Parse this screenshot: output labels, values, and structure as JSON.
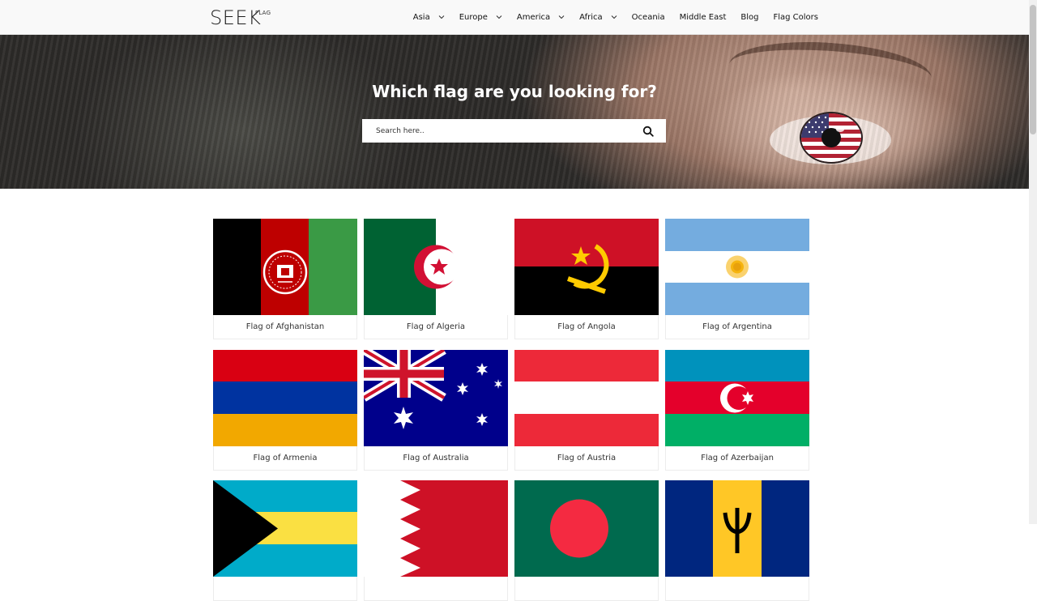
{
  "header": {
    "logo_main": "SEEK",
    "logo_sup": "FLAG",
    "nav": [
      {
        "label": "Asia",
        "dropdown": true
      },
      {
        "label": "Europe",
        "dropdown": true
      },
      {
        "label": "America",
        "dropdown": true
      },
      {
        "label": "Africa",
        "dropdown": true
      },
      {
        "label": "Oceania",
        "dropdown": false
      },
      {
        "label": "Middle East",
        "dropdown": false
      },
      {
        "label": "Blog",
        "dropdown": false
      },
      {
        "label": "Flag Colors",
        "dropdown": false
      }
    ]
  },
  "hero": {
    "title": "Which flag are you looking for?",
    "search_placeholder": "Search here.."
  },
  "flags": [
    {
      "label": "Flag of Afghanistan",
      "flag": "afghanistan"
    },
    {
      "label": "Flag of Algeria",
      "flag": "algeria"
    },
    {
      "label": "Flag of Angola",
      "flag": "angola"
    },
    {
      "label": "Flag of Argentina",
      "flag": "argentina"
    },
    {
      "label": "Flag of Armenia",
      "flag": "armenia"
    },
    {
      "label": "Flag of Australia",
      "flag": "australia"
    },
    {
      "label": "Flag of Austria",
      "flag": "austria"
    },
    {
      "label": "Flag of Azerbaijan",
      "flag": "azerbaijan"
    },
    {
      "label": "",
      "flag": "bahamas"
    },
    {
      "label": "",
      "flag": "bahrain"
    },
    {
      "label": "",
      "flag": "bangladesh"
    },
    {
      "label": "",
      "flag": "barbados"
    }
  ],
  "colors": {
    "header_bg": "#f9f9f9",
    "hero_title": "#ffffff"
  }
}
